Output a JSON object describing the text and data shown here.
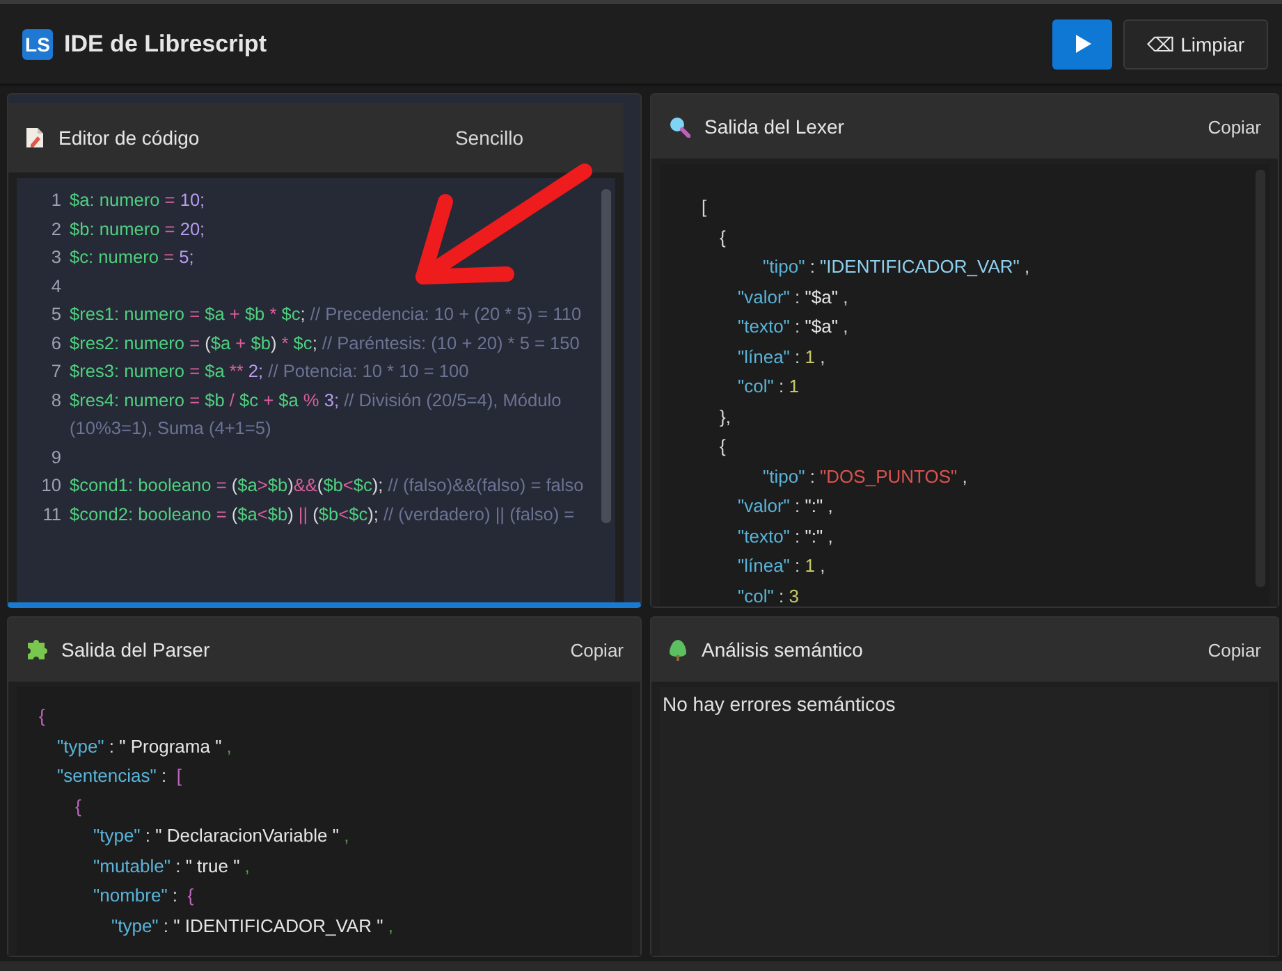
{
  "header": {
    "logo": "LS",
    "title": "IDE de Librescript",
    "clear_button": "⌫ Limpiar"
  },
  "panels": [
    {
      "kind": "editor",
      "title": "Editor de código",
      "action": "Sencillo",
      "focused": true,
      "lines": [
        {
          "number": "1",
          "tokens": [
            {
              "kind": "var",
              "text": "$a: numero"
            },
            {
              "kind": "op",
              "text": " = "
            },
            {
              "kind": "num",
              "text": "10;"
            }
          ]
        },
        {
          "number": "2",
          "tokens": [
            {
              "kind": "var",
              "text": "$b: numero"
            },
            {
              "kind": "op",
              "text": " = "
            },
            {
              "kind": "num",
              "text": "20;"
            }
          ]
        },
        {
          "number": "3",
          "tokens": [
            {
              "kind": "var",
              "text": "$c: numero"
            },
            {
              "kind": "op",
              "text": " = "
            },
            {
              "kind": "num",
              "text": "5;"
            }
          ]
        },
        {
          "number": "4"
        },
        {
          "number": "5",
          "tokens": [
            {
              "kind": "var",
              "text": "$res1: numero"
            },
            {
              "kind": "op",
              "text": " = "
            },
            {
              "kind": "var",
              "text": "$a"
            },
            {
              "kind": "op",
              "text": " + "
            },
            {
              "kind": "var",
              "text": "$b"
            },
            {
              "kind": "op",
              "text": " * "
            },
            {
              "kind": "var",
              "text": "$c"
            },
            {
              "kind": "punct",
              "text": ";"
            },
            {
              "kind": "comment",
              "text": " // Precedencia: 10 + (20 * 5) = 110"
            }
          ]
        },
        {
          "number": "6",
          "tokens": [
            {
              "kind": "var",
              "text": "$res2: numero"
            },
            {
              "kind": "op",
              "text": " = "
            },
            {
              "kind": "punct",
              "text": "("
            },
            {
              "kind": "var",
              "text": "$a"
            },
            {
              "kind": "op",
              "text": " + "
            },
            {
              "kind": "var",
              "text": "$b"
            },
            {
              "kind": "punct",
              "text": ")"
            },
            {
              "kind": "op",
              "text": " * "
            },
            {
              "kind": "var",
              "text": "$c"
            },
            {
              "kind": "punct",
              "text": ";"
            },
            {
              "kind": "comment",
              "text": " // Paréntesis: (10 + 20) * 5 = 150"
            }
          ]
        },
        {
          "number": "7",
          "tokens": [
            {
              "kind": "var",
              "text": "$res3: numero"
            },
            {
              "kind": "op",
              "text": " = "
            },
            {
              "kind": "var",
              "text": "$a"
            },
            {
              "kind": "op",
              "text": " ** "
            },
            {
              "kind": "num",
              "text": "2;"
            },
            {
              "kind": "comment",
              "text": " // Potencia: 10 * 10 = 100"
            }
          ]
        },
        {
          "number": "8",
          "tokens": [
            {
              "kind": "var",
              "text": "$res4: numero"
            },
            {
              "kind": "op",
              "text": " = "
            },
            {
              "kind": "var",
              "text": "$b"
            },
            {
              "kind": "op",
              "text": " / "
            },
            {
              "kind": "var",
              "text": "$c"
            },
            {
              "kind": "op",
              "text": " + "
            },
            {
              "kind": "var",
              "text": "$a"
            },
            {
              "kind": "op",
              "text": " % "
            },
            {
              "kind": "num",
              "text": "3;"
            },
            {
              "kind": "comment",
              "text": " // División (20/5=4), Módulo (10%3=1), Suma (4+1=5)"
            }
          ]
        },
        {
          "number": "9"
        },
        {
          "number": "10",
          "tokens": [
            {
              "kind": "var",
              "text": "$cond1: booleano"
            },
            {
              "kind": "op",
              "text": " = "
            },
            {
              "kind": "punct",
              "text": "("
            },
            {
              "kind": "var",
              "text": "$a"
            },
            {
              "kind": "op",
              "text": ">"
            },
            {
              "kind": "var",
              "text": "$b"
            },
            {
              "kind": "punct",
              "text": ")"
            },
            {
              "kind": "op",
              "text": "&&"
            },
            {
              "kind": "punct",
              "text": "("
            },
            {
              "kind": "var",
              "text": "$b"
            },
            {
              "kind": "op",
              "text": "<"
            },
            {
              "kind": "var",
              "text": "$c"
            },
            {
              "kind": "punct",
              "text": ");"
            },
            {
              "kind": "comment",
              "text": " // (falso)&&(falso) = falso"
            }
          ]
        },
        {
          "number": "11",
          "tokens": [
            {
              "kind": "var",
              "text": "$cond2: booleano"
            },
            {
              "kind": "op",
              "text": " = "
            },
            {
              "kind": "punct",
              "text": "("
            },
            {
              "kind": "var",
              "text": "$a"
            },
            {
              "kind": "op",
              "text": "<"
            },
            {
              "kind": "var",
              "text": "$b"
            },
            {
              "kind": "punct",
              "text": ")"
            },
            {
              "kind": "op",
              "text": " || "
            },
            {
              "kind": "punct",
              "text": "("
            },
            {
              "kind": "var",
              "text": "$b"
            },
            {
              "kind": "op",
              "text": "<"
            },
            {
              "kind": "var",
              "text": "$c"
            },
            {
              "kind": "punct",
              "text": ");"
            },
            {
              "kind": "comment",
              "text": " // (verdadero) || (falso) ="
            }
          ]
        }
      ]
    },
    {
      "kind": "lexer",
      "title": "Salida del Lexer",
      "action": "Copiar",
      "focused": false,
      "lines": [
        {
          "tokens": [
            {
              "kind": "punct",
              "text": "["
            }
          ],
          "children": [
            {
              "tokens": [
                {
                  "kind": "punct",
                  "text": "{"
                }
              ],
              "children": [
                {
                  "extra_indent": true,
                  "tokens": [
                    {
                      "kind": "key",
                      "text": "\"tipo\""
                    },
                    {
                      "kind": "punct",
                      "text": " : "
                    },
                    {
                      "kind": "tok_id",
                      "text": "\"IDENTIFICADOR_VAR\""
                    },
                    {
                      "kind": "punct",
                      "text": " ,"
                    }
                  ]
                },
                {
                  "extra_indent": false,
                  "tokens": [
                    {
                      "kind": "key",
                      "text": "\"valor\""
                    },
                    {
                      "kind": "punct",
                      "text": " : "
                    },
                    {
                      "kind": "str",
                      "text": "\"$a\""
                    },
                    {
                      "kind": "punct",
                      "text": " ,"
                    }
                  ]
                },
                {
                  "extra_indent": false,
                  "tokens": [
                    {
                      "kind": "key",
                      "text": "\"texto\""
                    },
                    {
                      "kind": "punct",
                      "text": " : "
                    },
                    {
                      "kind": "str",
                      "text": "\"$a\""
                    },
                    {
                      "kind": "punct",
                      "text": " ,"
                    }
                  ]
                },
                {
                  "extra_indent": false,
                  "tokens": [
                    {
                      "kind": "key",
                      "text": "\"línea\""
                    },
                    {
                      "kind": "punct",
                      "text": " : "
                    },
                    {
                      "kind": "lnum",
                      "text": "1"
                    },
                    {
                      "kind": "punct",
                      "text": " ,"
                    }
                  ]
                },
                {
                  "extra_indent": false,
                  "tokens": [
                    {
                      "kind": "key",
                      "text": "\"col\""
                    },
                    {
                      "kind": "punct",
                      "text": " : "
                    },
                    {
                      "kind": "lnum",
                      "text": "1"
                    }
                  ]
                }
              ]
            },
            {
              "tokens": [
                {
                  "kind": "punct",
                  "text": "},"
                }
              ]
            },
            {
              "tokens": [
                {
                  "kind": "punct",
                  "text": "{"
                }
              ],
              "children": [
                {
                  "extra_indent": true,
                  "tokens": [
                    {
                      "kind": "key",
                      "text": "\"tipo\""
                    },
                    {
                      "kind": "punct",
                      "text": " : "
                    },
                    {
                      "kind": "tok_sym",
                      "text": "\"DOS_PUNTOS\""
                    },
                    {
                      "kind": "punct",
                      "text": " ,"
                    }
                  ]
                },
                {
                  "extra_indent": false,
                  "tokens": [
                    {
                      "kind": "key",
                      "text": "\"valor\""
                    },
                    {
                      "kind": "punct",
                      "text": " : "
                    },
                    {
                      "kind": "str",
                      "text": "\":\""
                    },
                    {
                      "kind": "punct",
                      "text": " ,"
                    }
                  ]
                },
                {
                  "extra_indent": false,
                  "tokens": [
                    {
                      "kind": "key",
                      "text": "\"texto\""
                    },
                    {
                      "kind": "punct",
                      "text": " : "
                    },
                    {
                      "kind": "str",
                      "text": "\":\""
                    },
                    {
                      "kind": "punct",
                      "text": " ,"
                    }
                  ]
                },
                {
                  "extra_indent": false,
                  "tokens": [
                    {
                      "kind": "key",
                      "text": "\"línea\""
                    },
                    {
                      "kind": "punct",
                      "text": " : "
                    },
                    {
                      "kind": "lnum",
                      "text": "1"
                    },
                    {
                      "kind": "punct",
                      "text": " ,"
                    }
                  ]
                },
                {
                  "extra_indent": false,
                  "tokens": [
                    {
                      "kind": "key",
                      "text": "\"col\""
                    },
                    {
                      "kind": "punct",
                      "text": " : "
                    },
                    {
                      "kind": "lnum",
                      "text": "3"
                    }
                  ]
                }
              ]
            }
          ]
        }
      ]
    },
    {
      "kind": "parser",
      "title": "Salida del Parser",
      "action": "Copiar",
      "focused": false,
      "lines": [
        {
          "tokens": [
            {
              "kind": "brace",
              "text": "{"
            }
          ],
          "children": [
            {
              "tokens": [
                {
                  "kind": "pkey",
                  "text": "\"type\""
                },
                {
                  "kind": "punct",
                  "text": " : "
                },
                {
                  "kind": "str",
                  "text": "\" Programa \""
                },
                {
                  "kind": "comma",
                  "text": " ,"
                }
              ]
            },
            {
              "tokens": [
                {
                  "kind": "pkey",
                  "text": "\"sentencias\""
                },
                {
                  "kind": "punct",
                  "text": " :  "
                },
                {
                  "kind": "brace",
                  "text": "["
                }
              ],
              "children": [
                {
                  "tokens": [
                    {
                      "kind": "brace",
                      "text": "{"
                    }
                  ],
                  "children": [
                    {
                      "tokens": [
                        {
                          "kind": "pkey",
                          "text": "\"type\""
                        },
                        {
                          "kind": "punct",
                          "text": " : "
                        },
                        {
                          "kind": "str",
                          "text": "\" DeclaracionVariable \""
                        },
                        {
                          "kind": "comma",
                          "text": " ,"
                        }
                      ]
                    },
                    {
                      "tokens": [
                        {
                          "kind": "pkey",
                          "text": "\"mutable\""
                        },
                        {
                          "kind": "punct",
                          "text": " : "
                        },
                        {
                          "kind": "str",
                          "text": "\" true \""
                        },
                        {
                          "kind": "comma",
                          "text": " ,"
                        }
                      ]
                    },
                    {
                      "tokens": [
                        {
                          "kind": "pkey",
                          "text": "\"nombre\""
                        },
                        {
                          "kind": "punct",
                          "text": " :  "
                        },
                        {
                          "kind": "brace",
                          "text": "{"
                        }
                      ],
                      "children": [
                        {
                          "tokens": [
                            {
                              "kind": "pkey",
                              "text": "\"type\""
                            },
                            {
                              "kind": "punct",
                              "text": " : "
                            },
                            {
                              "kind": "str",
                              "text": "\" IDENTIFICADOR_VAR \""
                            },
                            {
                              "kind": "comma",
                              "text": " ,"
                            }
                          ]
                        }
                      ]
                    }
                  ]
                }
              ]
            }
          ]
        }
      ]
    },
    {
      "kind": "semantic",
      "title": "Análisis semántico",
      "action": "Copiar",
      "focused": false,
      "message": "No hay errores semánticos"
    }
  ]
}
